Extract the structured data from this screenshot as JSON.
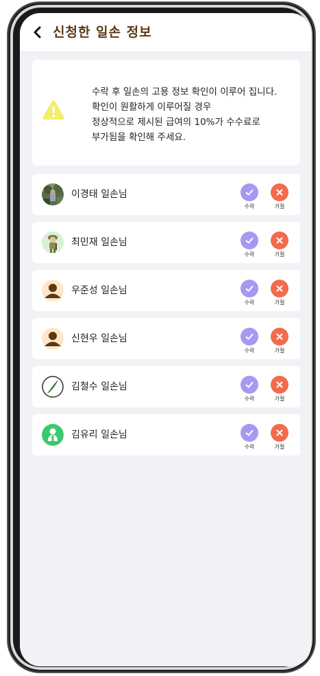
{
  "header": {
    "title": "신청한 일손 정보",
    "back_icon": "chevron-left-icon"
  },
  "notice": {
    "icon": "warning-icon",
    "lines": [
      "수락 후 일손의 고용 정보 확인이 이루어 집니다.",
      "확인이 원활하게 이루어질 경우",
      "정상적으로 제시된 급여의 10%가 수수료로",
      "부가됨을 확인해 주세요."
    ]
  },
  "actions": {
    "accept_label": "수락",
    "reject_label": "거절"
  },
  "workers": [
    {
      "name": "이경태 일손님",
      "avatar": "photo-avatar"
    },
    {
      "name": "최민재 일손님",
      "avatar": "soldier-avatar"
    },
    {
      "name": "우준성 일손님",
      "avatar": "default-person-avatar"
    },
    {
      "name": "신현우 일손님",
      "avatar": "default-person-avatar"
    },
    {
      "name": "김철수 일손님",
      "avatar": "leaf-logo-avatar"
    },
    {
      "name": "김유리 일손님",
      "avatar": "green-person-avatar"
    }
  ],
  "colors": {
    "title": "#5a3a14",
    "accept": "#a997f0",
    "reject": "#f36b4d",
    "warning": "#f3ee6b",
    "background": "#f1f2f6"
  }
}
